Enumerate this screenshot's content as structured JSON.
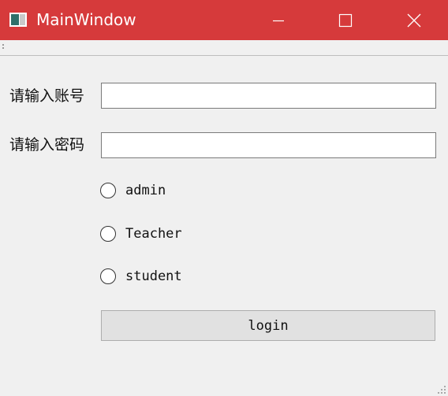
{
  "window": {
    "title": "MainWindow",
    "titlebar_color": "#d63a3b",
    "icon": "app-window-icon",
    "controls": {
      "minimize_icon": "minimize-icon",
      "maximize_icon": "maximize-icon",
      "close_icon": "close-icon"
    }
  },
  "form": {
    "account_label": "请输入账号",
    "account_value": "",
    "password_label": "请输入密码",
    "password_value": ""
  },
  "roles": [
    {
      "label": "admin",
      "checked": false
    },
    {
      "label": "Teacher",
      "checked": false
    },
    {
      "label": "student",
      "checked": false
    }
  ],
  "login_button": {
    "label": "login"
  }
}
